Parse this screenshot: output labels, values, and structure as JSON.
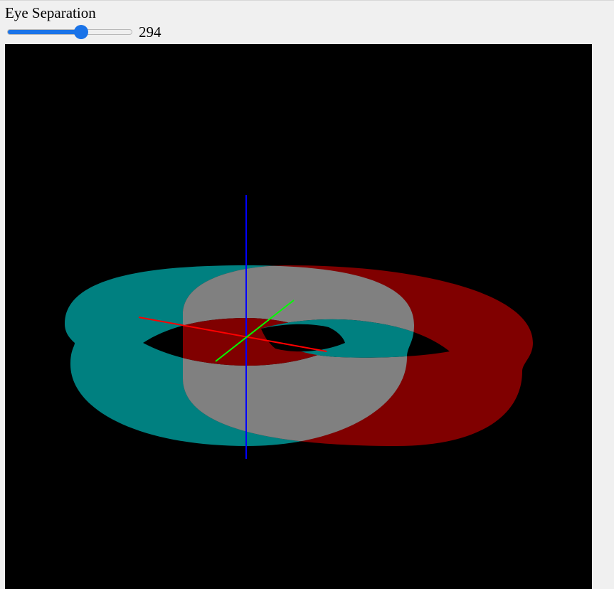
{
  "control": {
    "label": "Eye Separation",
    "value": "294",
    "fraction": 0.59
  },
  "scene": {
    "background": "#000000",
    "left_eye_color": "#008080",
    "right_eye_color": "#800000",
    "overlap_color": "#808080",
    "axis_x_color": "#ff0000",
    "axis_y_color": "#00ff00",
    "axis_z_color": "#0000ff"
  }
}
